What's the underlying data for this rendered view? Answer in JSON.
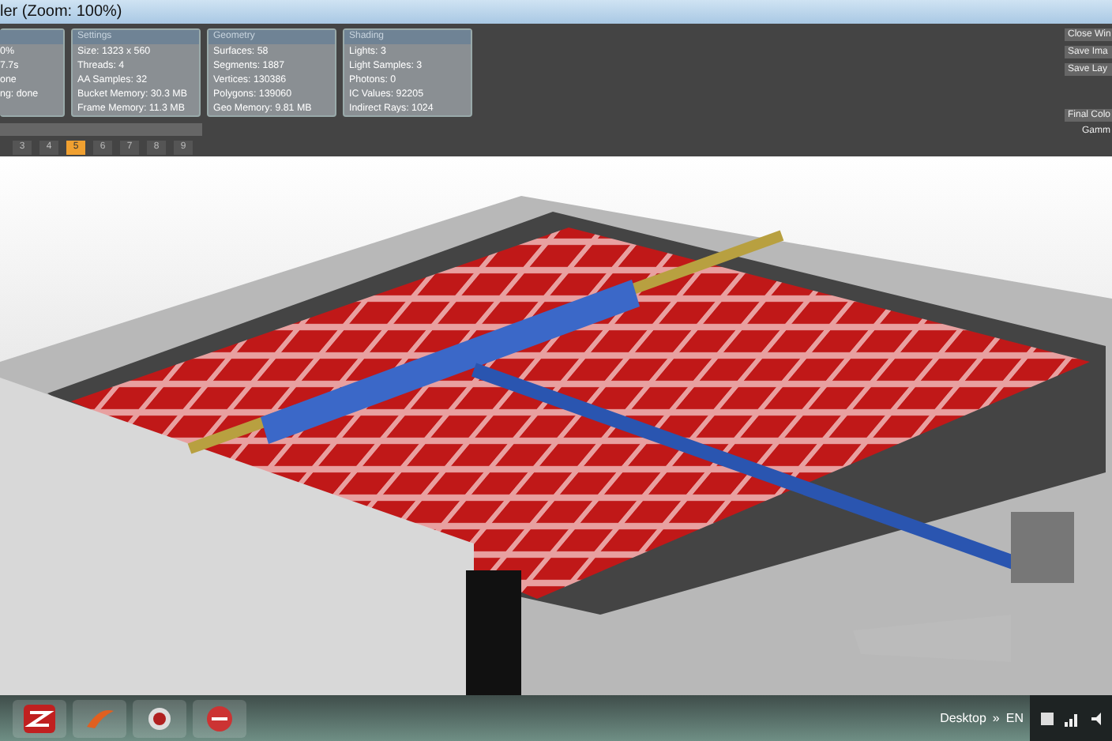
{
  "window": {
    "title": "ler (Zoom: 100%)"
  },
  "panels": [
    {
      "lines": [
        "0%",
        "7.7s",
        "one",
        "ng: done"
      ]
    },
    {
      "title": "Settings",
      "lines": [
        "Size: 1323 x 560",
        "Threads: 4",
        "AA Samples: 32",
        "Bucket Memory: 30.3 MB",
        "Frame Memory: 11.3 MB"
      ]
    },
    {
      "title": "Geometry",
      "lines": [
        "Surfaces: 58",
        "Segments: 1887",
        "Vertices: 130386",
        "Polygons: 139060",
        "Geo Memory: 9.81 MB"
      ]
    },
    {
      "title": "Shading",
      "lines": [
        "Lights: 3",
        "Light Samples: 3",
        "Photons: 0",
        "IC Values: 92205",
        "Indirect Rays: 1024"
      ]
    }
  ],
  "passes": [
    {
      "label": "3",
      "selected": false
    },
    {
      "label": "4",
      "selected": false
    },
    {
      "label": "5",
      "selected": true
    },
    {
      "label": "6",
      "selected": false
    },
    {
      "label": "7",
      "selected": false
    },
    {
      "label": "8",
      "selected": false
    },
    {
      "label": "9",
      "selected": false
    }
  ],
  "side_buttons": [
    {
      "label": "Close Win",
      "kind": "button"
    },
    {
      "label": "Save Ima",
      "kind": "button"
    },
    {
      "label": "Save Lay",
      "kind": "button"
    },
    {
      "label": "Final Colo",
      "kind": "button"
    },
    {
      "label": "Gamm",
      "kind": "label"
    }
  ],
  "taskbar": {
    "desktop": "Desktop",
    "chevron": "»",
    "language": "EN"
  }
}
